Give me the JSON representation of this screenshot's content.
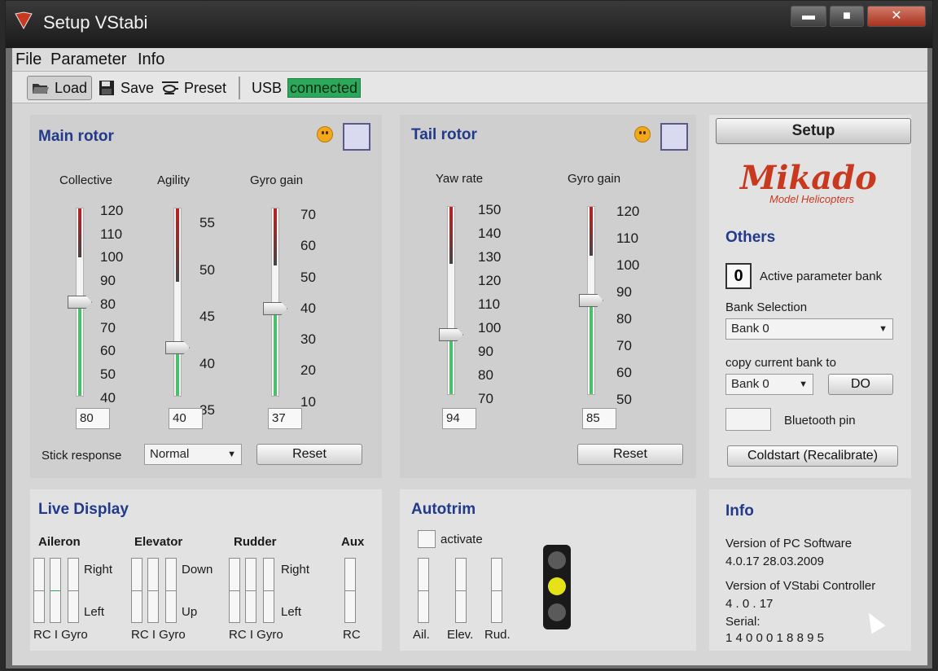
{
  "window": {
    "title": "Setup VStabi",
    "min_glyph": "▬",
    "max_glyph": "■",
    "close_glyph": "✕"
  },
  "menu": {
    "file": "File",
    "parameter": "Parameter",
    "info": "Info"
  },
  "toolbar": {
    "load": "Load",
    "save": "Save",
    "preset": "Preset",
    "usb": "USB",
    "status": "connected",
    "status_color": "#2ca85a"
  },
  "main_rotor": {
    "title": "Main rotor",
    "sliders": [
      {
        "label": "Collective",
        "ticks": [
          "120",
          "110",
          "100",
          "90",
          "80",
          "70",
          "60",
          "50",
          "40"
        ],
        "value": "80",
        "min": 40,
        "max": 120
      },
      {
        "label": "Agility",
        "ticks": [
          "55",
          "50",
          "45",
          "40",
          "35"
        ],
        "value": "40",
        "min": 35,
        "max": 55
      },
      {
        "label": "Gyro gain",
        "ticks": [
          "70",
          "60",
          "50",
          "40",
          "30",
          "20",
          "10"
        ],
        "value": "37",
        "min": 10,
        "max": 70
      }
    ],
    "stick_label": "Stick response",
    "stick_value": "Normal",
    "reset": "Reset"
  },
  "tail_rotor": {
    "title": "Tail rotor",
    "sliders": [
      {
        "label": "Yaw rate",
        "ticks": [
          "150",
          "140",
          "130",
          "120",
          "110",
          "100",
          "90",
          "80",
          "70"
        ],
        "value": "94",
        "min": 70,
        "max": 150
      },
      {
        "label": "Gyro gain",
        "ticks": [
          "120",
          "110",
          "100",
          "90",
          "80",
          "70",
          "60",
          "50"
        ],
        "value": "85",
        "min": 50,
        "max": 120
      }
    ],
    "reset": "Reset"
  },
  "right": {
    "setup": "Setup",
    "logo": "Mikado",
    "logo_sub": "Model Helicopters",
    "others_title": "Others",
    "bank_value": "0",
    "active_bank_label": "Active parameter bank",
    "bank_selection_label": "Bank Selection",
    "bank_selection_value": "Bank 0",
    "copy_label": "copy current bank to",
    "copy_value": "Bank 0",
    "do": "DO",
    "bluetooth_label": "Bluetooth pin",
    "coldstart": "Coldstart (Recalibrate)"
  },
  "live": {
    "title": "Live Display",
    "groups": [
      {
        "name": "Aileron",
        "top": "Right",
        "bottom": "Left",
        "foot": "RC  I  Gyro"
      },
      {
        "name": "Elevator",
        "top": "Down",
        "bottom": "Up",
        "foot": "RC  I  Gyro"
      },
      {
        "name": "Rudder",
        "top": "Right",
        "bottom": "Left",
        "foot": "RC  I  Gyro"
      },
      {
        "name": "Aux",
        "foot": "RC"
      }
    ]
  },
  "autotrim": {
    "title": "Autotrim",
    "activate": "activate",
    "labels": [
      "Ail.",
      "Elev.",
      "Rud."
    ],
    "lamp_color": "#e6e21a"
  },
  "info": {
    "title": "Info",
    "pc_label": "Version of PC Software",
    "pc_value": "4.0.17  28.03.2009",
    "ctrl_label": "Version of VStabi Controller",
    "ctrl_value": "4 . 0 . 17",
    "serial_label": "Serial:",
    "serial_value": "1 4 0 0 0 1 8 8 9 5"
  }
}
